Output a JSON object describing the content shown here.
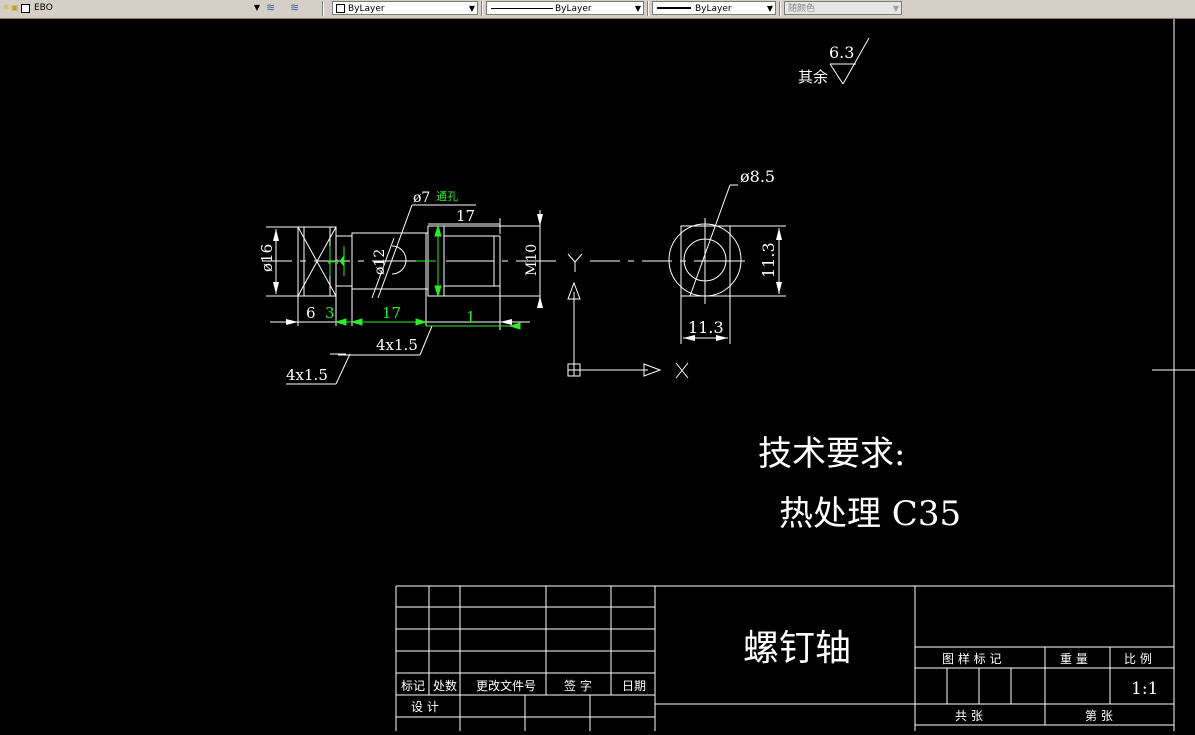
{
  "toolbar": {
    "layer_name": "EBO",
    "color_combo": "ByLayer",
    "linetype_combo": "ByLayer",
    "lineweight_combo": "ByLayer",
    "plotstyle_combo": "随颜色",
    "icons": [
      "sun-icon",
      "lock-icon",
      "layer-color-icon",
      "layers-icon",
      "layer-previous-icon",
      "chevron-down-icon"
    ]
  },
  "colors": {
    "background": "#000000",
    "lines": "#ffffff",
    "highlight": "#2dea2d"
  },
  "drawing": {
    "roughness_value": "6.3",
    "roughness_label": "其余",
    "dim_dia16": "ø16",
    "dim_1a": "1",
    "dim_dia12": "ø12",
    "dim_dia7": "ø7",
    "dim_through_hole": "通孔",
    "dim_17_top": "17",
    "dim_m10": "M10",
    "dim_6": "6",
    "dim_3": "3",
    "dim_17_bottom": "17",
    "dim_1b": "1",
    "dim_chamfer1": "4x1.5",
    "dim_chamfer2": "4x1.5",
    "dim_dia8_5": "ø8.5",
    "dim_11_3_vertical": "11.3",
    "dim_11_3_horizontal": "11.3",
    "ucs_y": "Y",
    "ucs_x": "X",
    "tech_title": "技术要求:",
    "tech_content": "热处理 C35"
  },
  "title_block": {
    "part_name": "螺钉轴",
    "col_mark": "标记",
    "col_count": "处数",
    "col_doc": "更改文件号",
    "col_sign": "签 字",
    "col_date": "日期",
    "row_design": "设 计",
    "h_drawing_mark": "图 样 标 记",
    "h_weight": "重 量",
    "h_scale": "比 例",
    "scale_value": "1:1",
    "total_sheets": "共    张",
    "sheet_no": "第    张"
  }
}
